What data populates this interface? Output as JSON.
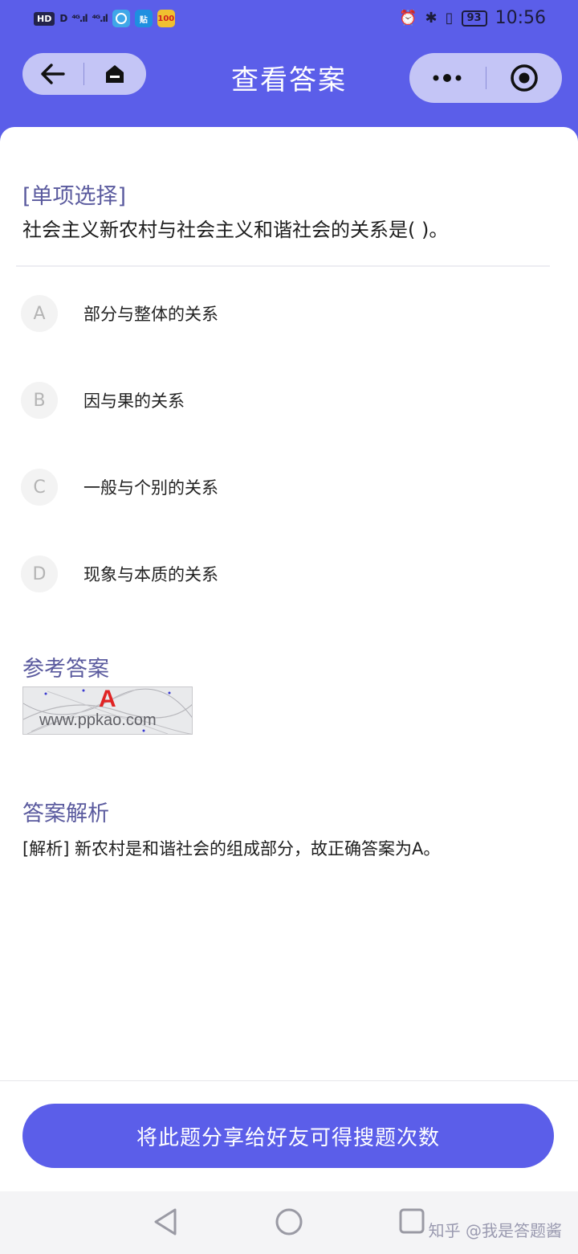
{
  "status_bar": {
    "hd": "HD",
    "hd_sub": "D",
    "signal1": "⁴ᴳ.ıl",
    "signal2": "⁴ᴳ.ıl",
    "app2": "贴",
    "app3": "100",
    "battery": "93",
    "time": "10:56"
  },
  "header": {
    "title": "查看答案"
  },
  "question": {
    "type_label": "[单项选择]",
    "text": "社会主义新农村与社会主义和谐社会的关系是( )。",
    "options": [
      {
        "letter": "A",
        "text": "部分与整体的关系"
      },
      {
        "letter": "B",
        "text": "因与果的关系"
      },
      {
        "letter": "C",
        "text": "一般与个别的关系"
      },
      {
        "letter": "D",
        "text": "现象与本质的关系"
      }
    ]
  },
  "answer": {
    "title": "参考答案",
    "image_letter": "A",
    "image_watermark": "www.ppkao.com"
  },
  "analysis": {
    "title": "答案解析",
    "text": "[解析] 新农村是和谐社会的组成部分，故正确答案为A。"
  },
  "share_button": {
    "label": "将此题分享给好友可得搜题次数"
  },
  "watermark": {
    "text": "知乎 @我是答题酱"
  },
  "colors": {
    "accent": "#5b5ee9",
    "section_title": "#5a5a9e",
    "answer_letter": "#e02424"
  }
}
